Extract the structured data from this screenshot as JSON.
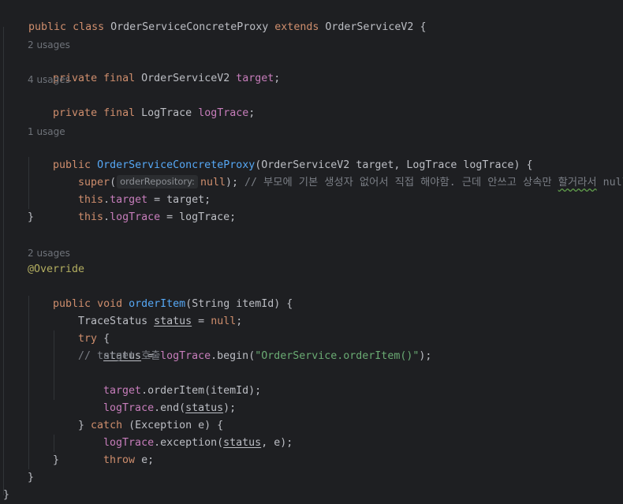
{
  "code": {
    "lines": {
      "class_decl": {
        "kw1": "public",
        "kw2": "class",
        "name": "OrderServiceConcreteProxy",
        "kw3": "extends",
        "parent": "OrderServiceV2",
        "brace": "{"
      },
      "usage_target": "2 usages",
      "field_target": {
        "kw1": "private",
        "kw2": "final",
        "type": "OrderServiceV2",
        "name": "target",
        "semi": ";"
      },
      "usage_logtrace": "4 usages",
      "field_logtrace": {
        "kw1": "private",
        "kw2": "final",
        "type": "LogTrace",
        "name": "logTrace",
        "semi": ";"
      },
      "usage_ctor": "1 usage",
      "ctor_decl": {
        "kw": "public",
        "name": "OrderServiceConcreteProxy",
        "params": "(OrderServiceV2 target, LogTrace logTrace) {"
      },
      "super_call": {
        "kw": "super",
        "open": "(",
        "hint": "orderRepository:",
        "arg": "null",
        "close": ");",
        "comment_a": "// 부모에 기본 생성자 없어서 직접 해야함. 근데 안쓰고 상속만 ",
        "comment_typo": "할거라서",
        "comment_b": " null"
      },
      "assign_target": {
        "kw": "this",
        "dot": ".",
        "field": "target",
        "rest": " = target;"
      },
      "assign_logtrace": {
        "kw": "this",
        "dot": ".",
        "field": "logTrace",
        "rest": " = logTrace;"
      },
      "ctor_close": "}",
      "usage_method": "2 usages",
      "annotation": "@Override",
      "method_decl": {
        "kw1": "public",
        "kw2": "void",
        "name": "orderItem",
        "params": "(String itemId) {"
      },
      "status_decl": {
        "type": "TraceStatus",
        "var": "status",
        "eq": " = ",
        "kw": "null",
        "semi": ";"
      },
      "try_open": {
        "kw": "try",
        "brace": " {"
      },
      "status_assign": {
        "var": "status",
        "eq": " = ",
        "field": "logTrace",
        "call": ".begin(",
        "arg": "\"OrderService.orderItem()\"",
        "close": ");"
      },
      "comment_call": "// target 호출",
      "target_call": {
        "field": "target",
        "call": ".orderItem(itemId);"
      },
      "end_call": {
        "field": "logTrace",
        "call": ".end(",
        "var": "status",
        "close": ");"
      },
      "catch_line": {
        "pre": "} ",
        "kw": "catch",
        "rest": " (Exception e) {"
      },
      "exception_call": {
        "field": "logTrace",
        "call": ".exception(",
        "var": "status",
        "rest": ", e);"
      },
      "throw_line": {
        "kw": "throw",
        "rest": " e;"
      },
      "catch_close": "}",
      "method_close": "}",
      "class_close": "}"
    }
  }
}
